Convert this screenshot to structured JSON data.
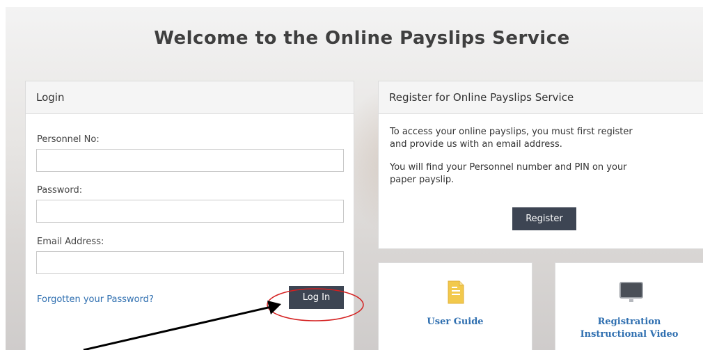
{
  "page": {
    "title": "Welcome to the Online Payslips Service"
  },
  "login": {
    "heading": "Login",
    "personnel_label": "Personnel No:",
    "personnel_value": "",
    "password_label": "Password:",
    "password_value": "",
    "email_label": "Email Address:",
    "email_value": "",
    "forgot_link": "Forgotten your Password?",
    "login_button": "Log In"
  },
  "register": {
    "heading": "Register for Online Payslips Service",
    "paragraph1_line1": "To access your online payslips, you must first register",
    "paragraph1_line2": "and provide us with an email address.",
    "paragraph2_line1": "You will find your Personnel number and PIN on your",
    "paragraph2_line2": "paper payslip.",
    "button": "Register"
  },
  "tiles": [
    {
      "label_line1": "User Guide",
      "label_line2": "",
      "icon": "document-icon"
    },
    {
      "label_line1": "Registration",
      "label_line2": "Instructional Video",
      "icon": "monitor-icon"
    }
  ],
  "colors": {
    "button": "#3d4553",
    "link": "#2f6fb0",
    "annotation_circle": "#d42020",
    "annotation_arrow": "#000000",
    "document_icon": "#f2c94c"
  }
}
